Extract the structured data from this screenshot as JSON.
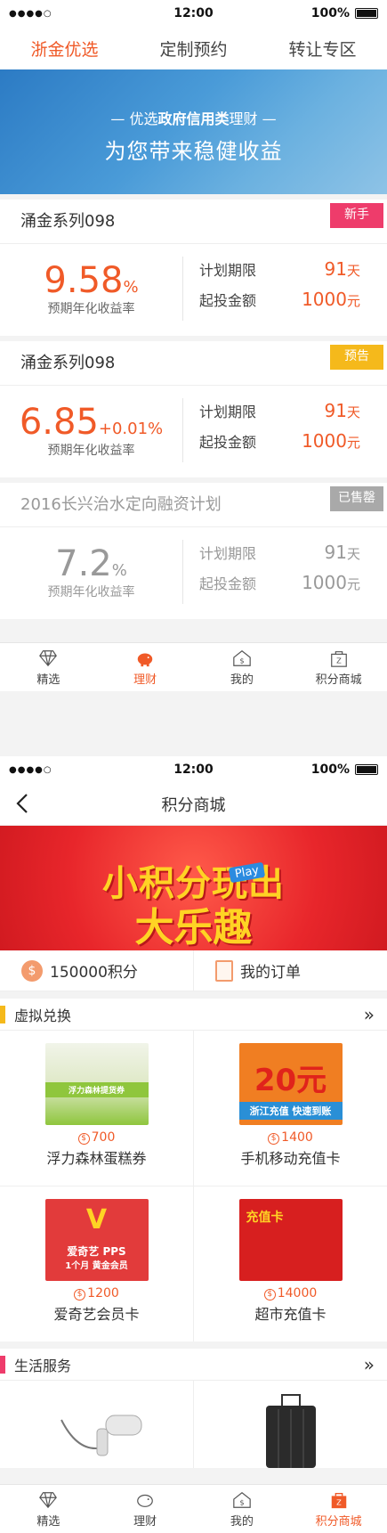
{
  "screen1": {
    "status": {
      "signal": "●●●●○",
      "time": "12:00",
      "battery": "100%"
    },
    "tabs": [
      {
        "label": "浙金优选",
        "active": true
      },
      {
        "label": "定制预约",
        "active": false
      },
      {
        "label": "转让专区",
        "active": false
      }
    ],
    "banner": {
      "line1_prefix": "— 优选",
      "line1_bold": "政府信用类",
      "line1_suffix": "理财 —",
      "line2": "为您带来稳健收益"
    },
    "products": [
      {
        "name": "涌金系列098",
        "badge": "新手",
        "rate": "9.58",
        "rate_unit": "%",
        "rate_label": "预期年化收益率",
        "term_label": "计划期限",
        "term_value": "91",
        "term_unit": "天",
        "min_label": "起投金额",
        "min_value": "1000",
        "min_unit": "元"
      },
      {
        "name": "涌金系列098",
        "badge": "预告",
        "rate": "6.85",
        "rate_unit": "+0.01%",
        "rate_label": "预期年化收益率",
        "term_label": "计划期限",
        "term_value": "91",
        "term_unit": "天",
        "min_label": "起投金额",
        "min_value": "1000",
        "min_unit": "元"
      },
      {
        "name": "2016长兴治水定向融资计划",
        "badge": "已售罄",
        "rate": "7.2",
        "rate_unit": "%",
        "rate_label": "预期年化收益率",
        "term_label": "计划期限",
        "term_value": "91",
        "term_unit": "天",
        "min_label": "起投金额",
        "min_value": "1000",
        "min_unit": "元"
      }
    ],
    "tabbar": [
      {
        "label": "精选",
        "icon": "diamond-icon",
        "active": false
      },
      {
        "label": "理财",
        "icon": "piggy-bank-icon",
        "active": true
      },
      {
        "label": "我的",
        "icon": "home-dollar-icon",
        "active": false
      },
      {
        "label": "积分商城",
        "icon": "shopping-bag-icon",
        "active": false
      }
    ]
  },
  "screen2": {
    "status": {
      "signal": "●●●●○",
      "time": "12:00",
      "battery": "100%"
    },
    "title": "积分商城",
    "banner": {
      "line1": "小积分玩出",
      "line2": "大乐趣",
      "play": "Play"
    },
    "points": {
      "value": "150000积分",
      "orders": "我的订单"
    },
    "virtual": {
      "title": "虚拟兑换",
      "items": [
        {
          "name": "浮力森林蛋糕券",
          "price": "700",
          "img_text": "浮力森林提货券"
        },
        {
          "name": "手机移动充值卡",
          "price": "1400",
          "img_text": "20元",
          "img_sub": "浙江充值 快速到账"
        },
        {
          "name": "爱奇艺会员卡",
          "price": "1200",
          "img_text": "爱奇艺 PPS",
          "img_sub": "1个月 黄金会员"
        },
        {
          "name": "超市充值卡",
          "price": "14000",
          "img_text": "充值卡"
        }
      ]
    },
    "life": {
      "title": "生活服务"
    },
    "tabbar": [
      {
        "label": "精选",
        "active": false
      },
      {
        "label": "理财",
        "active": false
      },
      {
        "label": "我的",
        "active": false
      },
      {
        "label": "积分商城",
        "active": true
      }
    ]
  },
  "colors": {
    "accent": "#f05a28",
    "pink": "#ee3c6b",
    "yellow": "#f5b91b",
    "gray": "#a9a9a9"
  }
}
